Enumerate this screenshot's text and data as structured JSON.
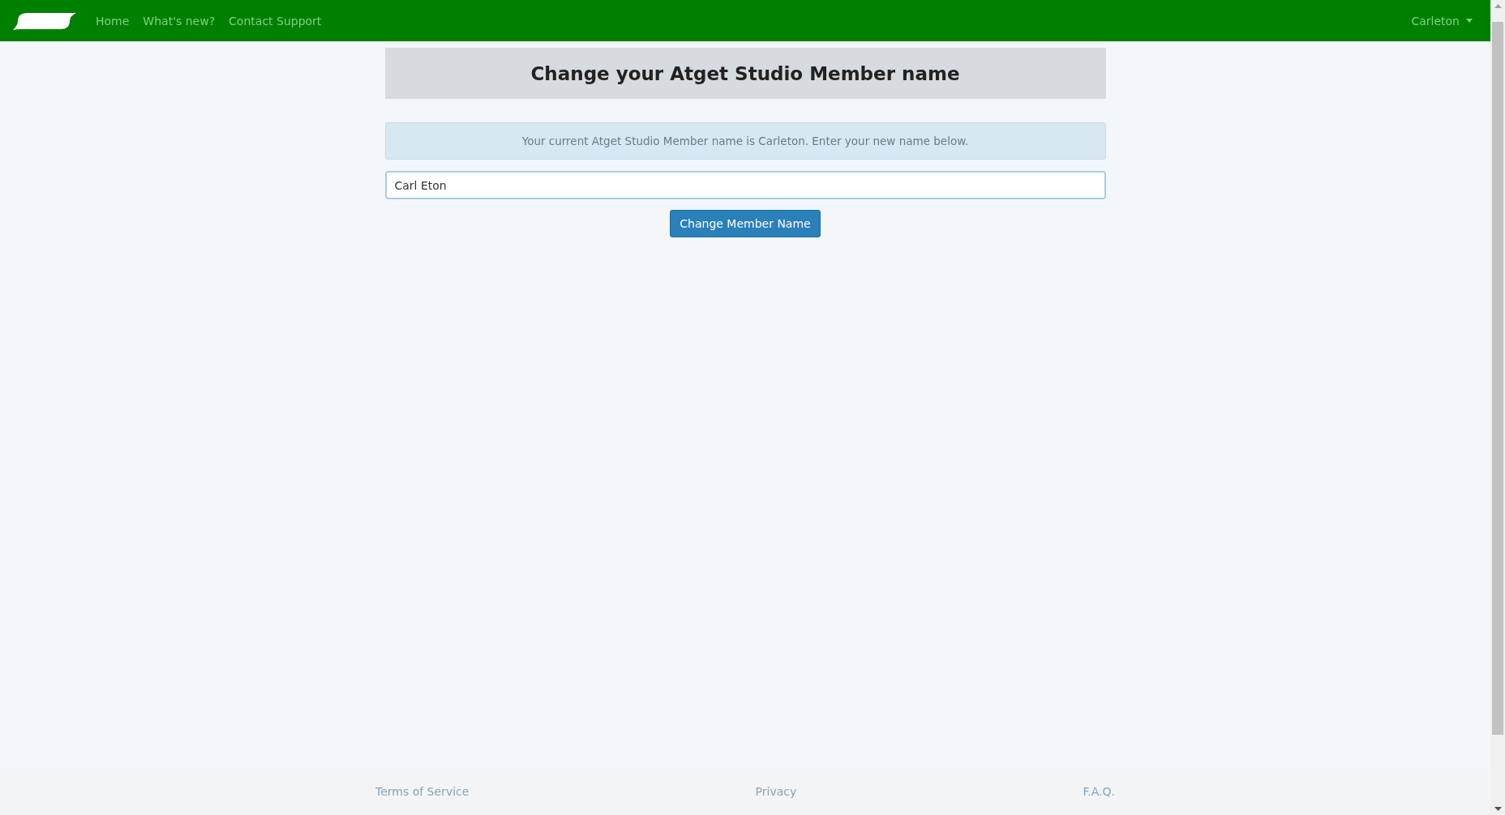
{
  "navbar": {
    "links": [
      {
        "label": "Home"
      },
      {
        "label": "What's new?"
      },
      {
        "label": "Contact Support"
      }
    ],
    "user_menu": {
      "label": "Carleton"
    }
  },
  "header": {
    "title": "Change your Atget Studio Member name"
  },
  "alert": {
    "text": "Your current Atget Studio Member name is Carleton. Enter your new name below."
  },
  "name_field": {
    "value": "Carl Eton"
  },
  "submit_button": {
    "label": "Change Member Name"
  },
  "footer": {
    "links": [
      {
        "label": "Terms of Service"
      },
      {
        "label": "Privacy"
      },
      {
        "label": "F.A.Q."
      }
    ]
  }
}
